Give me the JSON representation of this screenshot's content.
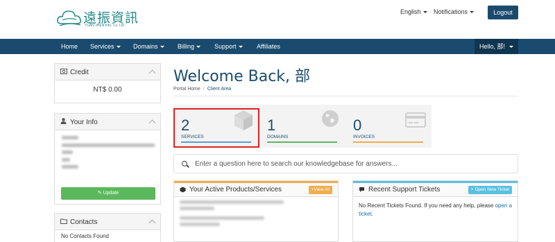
{
  "header": {
    "logo_title": "遠振資訊",
    "logo_subtitle": "YUAN JHEN Info. Co. Ltd",
    "language": "English",
    "notifications": "Notifications",
    "logout": "Logout"
  },
  "nav": {
    "items": [
      "Home",
      "Services",
      "Domains",
      "Billing",
      "Support",
      "Affiliates"
    ],
    "hello": "Hello, 部!"
  },
  "sidebar": {
    "credit": {
      "title": "Credit",
      "value": "NT$ 0.00"
    },
    "your_info": {
      "title": "Your Info",
      "update_label": "Update"
    },
    "contacts": {
      "title": "Contacts",
      "empty_text": "No Contacts Found"
    }
  },
  "main": {
    "welcome": "Welcome Back, 部",
    "breadcrumb": [
      "Portal Home",
      "Client Area"
    ],
    "tiles": [
      {
        "count": "2",
        "label": "SERVICES",
        "color": "#5b9bd5"
      },
      {
        "count": "1",
        "label": "DOMAINS",
        "color": "#5cb85c"
      },
      {
        "count": "0",
        "label": "INVOICES",
        "color": "#f0ad4e"
      }
    ],
    "search_placeholder": "Enter a question here to search our knowledgebase for answers...",
    "products": {
      "title": "Your Active Products/Services",
      "button": "View All",
      "accent": "#f0ad4e"
    },
    "tickets": {
      "title": "Recent Support Tickets",
      "button": "Open New Ticket",
      "accent": "#5bc0de",
      "text": "No Recent Tickets Found. If you need any help, please",
      "link": "open a ticket",
      "suffix": "."
    }
  },
  "colors": {
    "primary": "#1a4b6e",
    "highlight": "#e0201e",
    "success": "#5cb85c"
  }
}
